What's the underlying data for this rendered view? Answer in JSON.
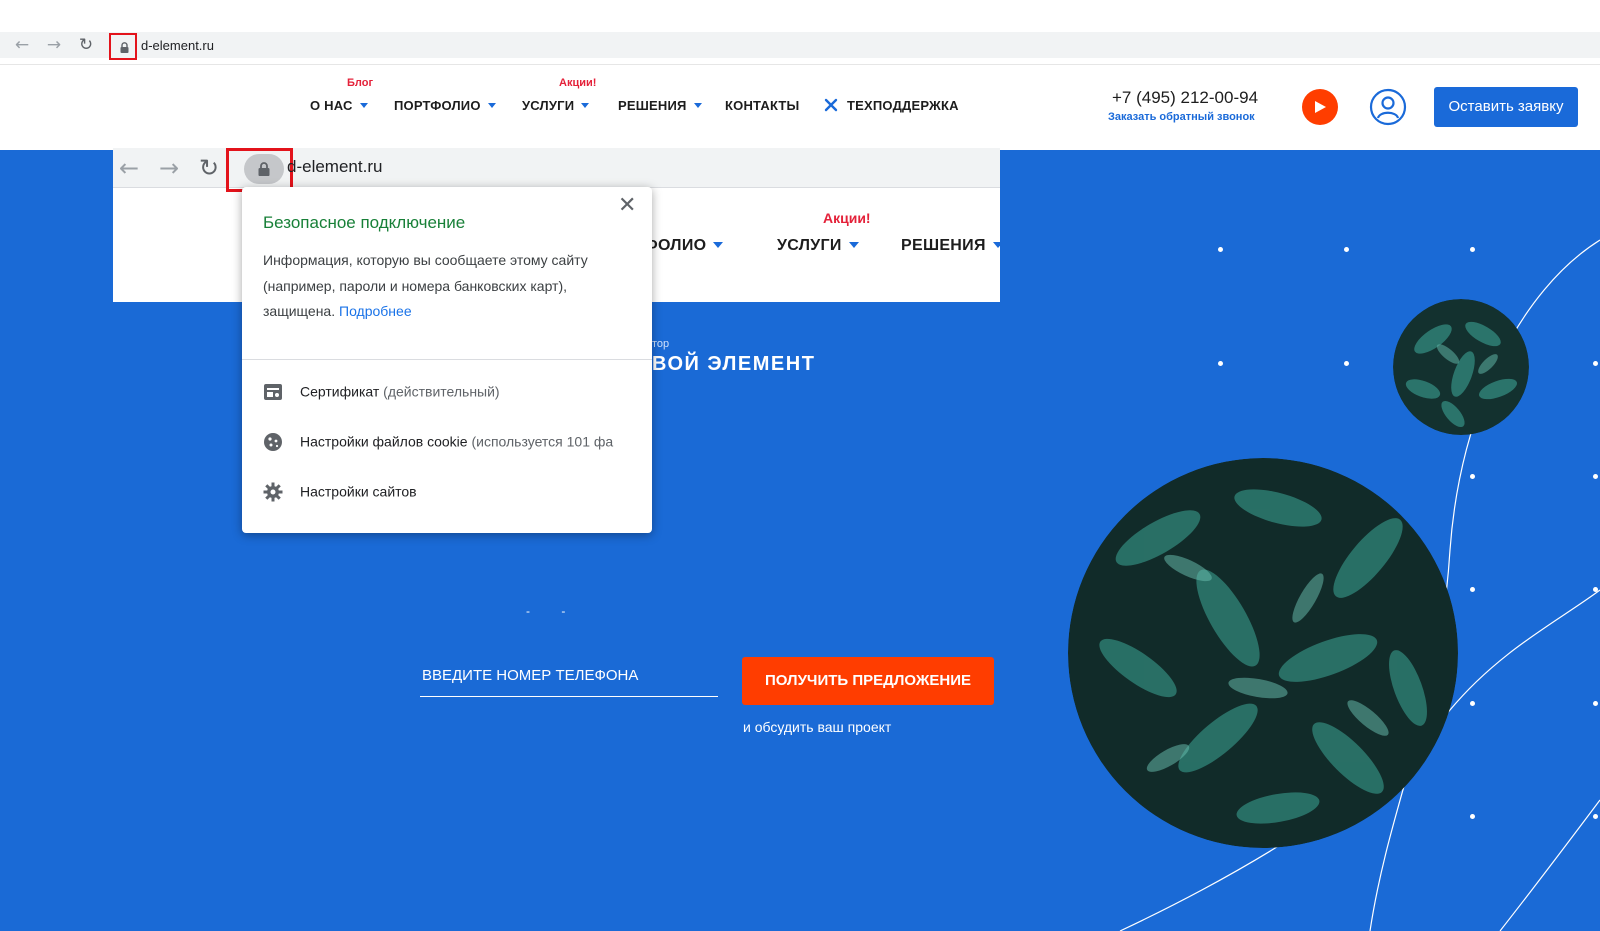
{
  "browser": {
    "url": "d-element.ru",
    "back_icon": "arrow-left-icon",
    "forward_icon": "arrow-right-icon",
    "reload_icon": "reload-icon",
    "lock_icon": "lock-icon",
    "highlight_color": "#e3131b"
  },
  "header": {
    "nav": [
      {
        "label": "О НАС",
        "tag": "Блог",
        "dropdown": true
      },
      {
        "label": "ПОРТФОЛИО",
        "tag": "",
        "dropdown": true
      },
      {
        "label": "УСЛУГИ",
        "tag": "Акции!",
        "dropdown": true
      },
      {
        "label": "РЕШЕНИЯ",
        "tag": "",
        "dropdown": true
      },
      {
        "label": "КОНТАКТЫ",
        "tag": "",
        "dropdown": false
      },
      {
        "label": "ТЕХПОДДЕРЖКА",
        "tag": "",
        "dropdown": false
      }
    ],
    "phone": "+7 (495) 212-00-94",
    "callback": "Заказать обратный звонок",
    "cta": "Оставить заявку",
    "accent_color": "#1a6ad9",
    "tag_color": "#e4223a"
  },
  "hero": {
    "eyebrow": "тор",
    "title": "ВОЙ ЭЛЕМЕНТ",
    "dash_hint": "- -",
    "phone_placeholder": "ВВЕДИТЕ НОМЕР ТЕЛЕФОНА",
    "offer_button": "ПОЛУЧИТЬ ПРЕДЛОЖЕНИЕ",
    "offer_sub": "и обсудить ваш проект",
    "background_color": "#1a6ad6",
    "button_color": "#ff3d00"
  },
  "inset": {
    "url": "d-element.ru",
    "nav": [
      "ФОЛИО",
      "УСЛУГИ",
      "РЕШЕНИЯ"
    ],
    "tag": "Акции!"
  },
  "popup": {
    "title": "Безопасное подключение",
    "text": "Информация, которую вы сообщаете этому сайту (например, пароли и номера банковских карт), защищена.",
    "link": "Подробнее",
    "close_icon": "close-icon",
    "rows": [
      {
        "label": "Сертификат",
        "detail": "(действительный)",
        "icon": "certificate-icon"
      },
      {
        "label": "Настройки файлов cookie",
        "detail": "(используется 101 фа",
        "icon": "cookie-icon"
      },
      {
        "label": "Настройки сайтов",
        "detail": "",
        "icon": "gear-icon"
      }
    ]
  }
}
